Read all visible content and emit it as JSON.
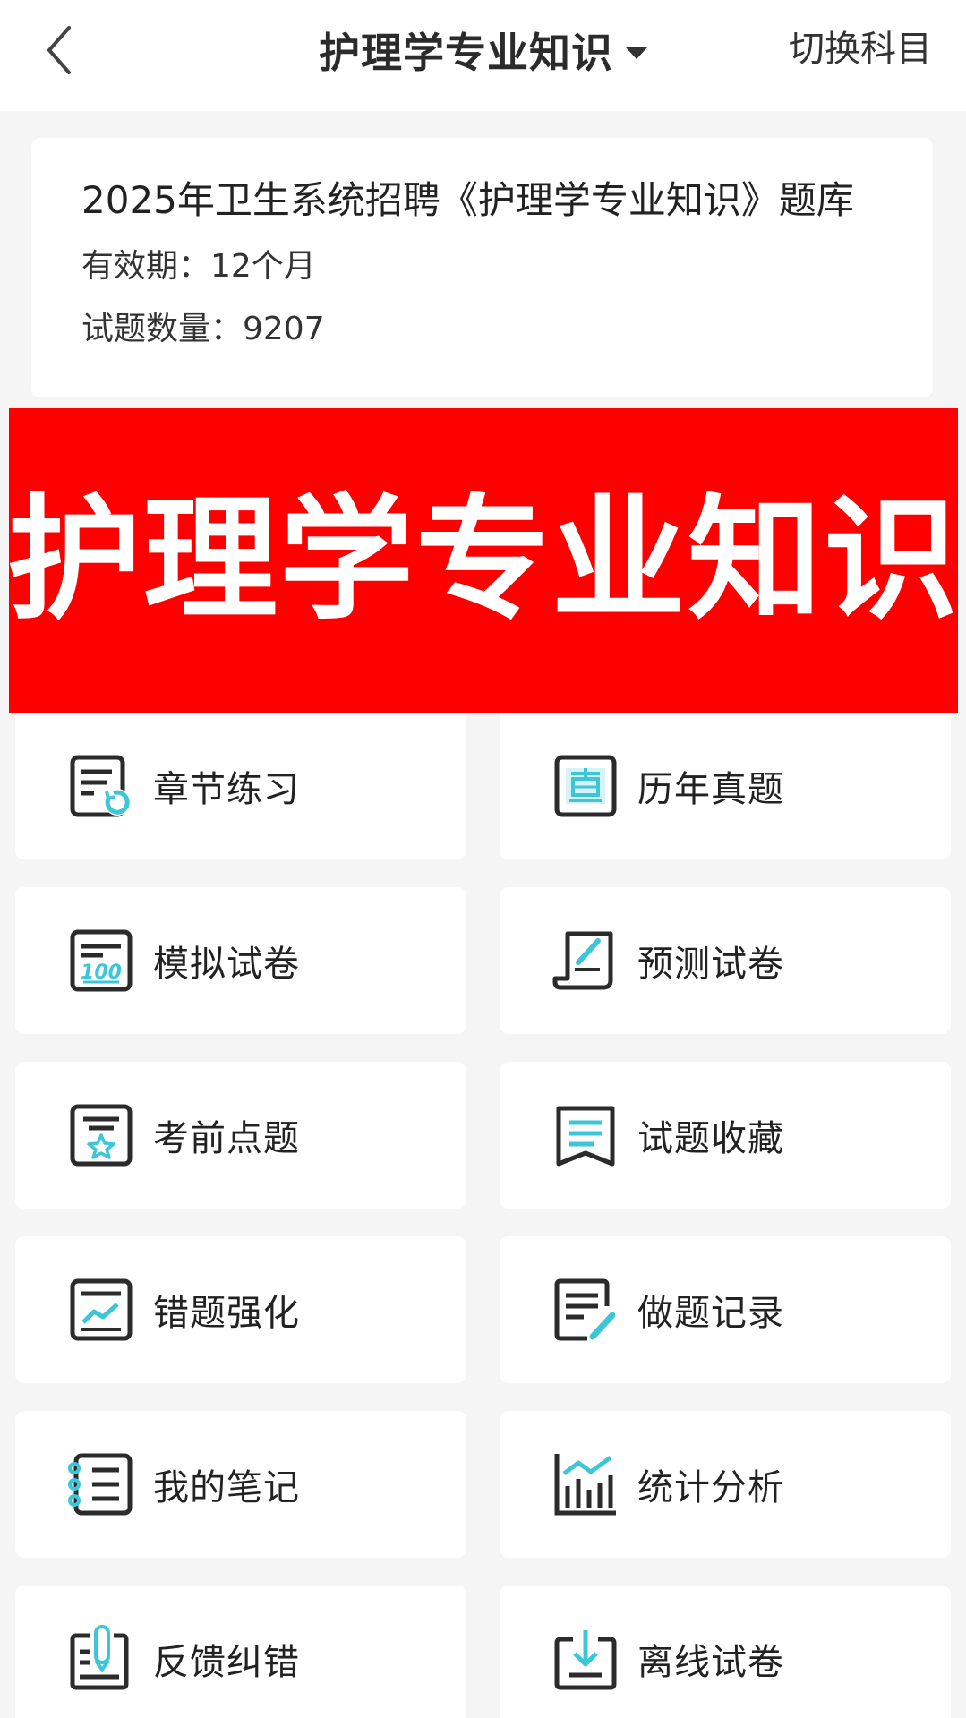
{
  "header": {
    "back_icon": "chevron-left-icon",
    "title": "护理学专业知识",
    "dropdown_icon": "caret-down-icon",
    "switch_label": "切换科目"
  },
  "info": {
    "title": "2025年卫生系统招聘《护理学专业知识》题库",
    "validity": "有效期：12个月",
    "count": "试题数量：9207"
  },
  "banner": {
    "text": "护理学专业知识",
    "color": "#fe0000"
  },
  "menu": [
    {
      "label": "章节练习",
      "icon": "chapter-practice-icon"
    },
    {
      "label": "历年真题",
      "icon": "past-exams-icon"
    },
    {
      "label": "模拟试卷",
      "icon": "mock-paper-icon"
    },
    {
      "label": "预测试卷",
      "icon": "prediction-paper-icon"
    },
    {
      "label": "考前点题",
      "icon": "pre-exam-tips-icon"
    },
    {
      "label": "试题收藏",
      "icon": "favorites-icon"
    },
    {
      "label": "错题强化",
      "icon": "wrong-questions-icon"
    },
    {
      "label": "做题记录",
      "icon": "practice-record-icon"
    },
    {
      "label": "我的笔记",
      "icon": "notes-icon"
    },
    {
      "label": "统计分析",
      "icon": "statistics-icon"
    },
    {
      "label": "反馈纠错",
      "icon": "feedback-icon"
    },
    {
      "label": "离线试卷",
      "icon": "offline-download-icon"
    }
  ],
  "colors": {
    "accent": "#3cc6d8",
    "icon_stroke": "#2b2b2b"
  }
}
